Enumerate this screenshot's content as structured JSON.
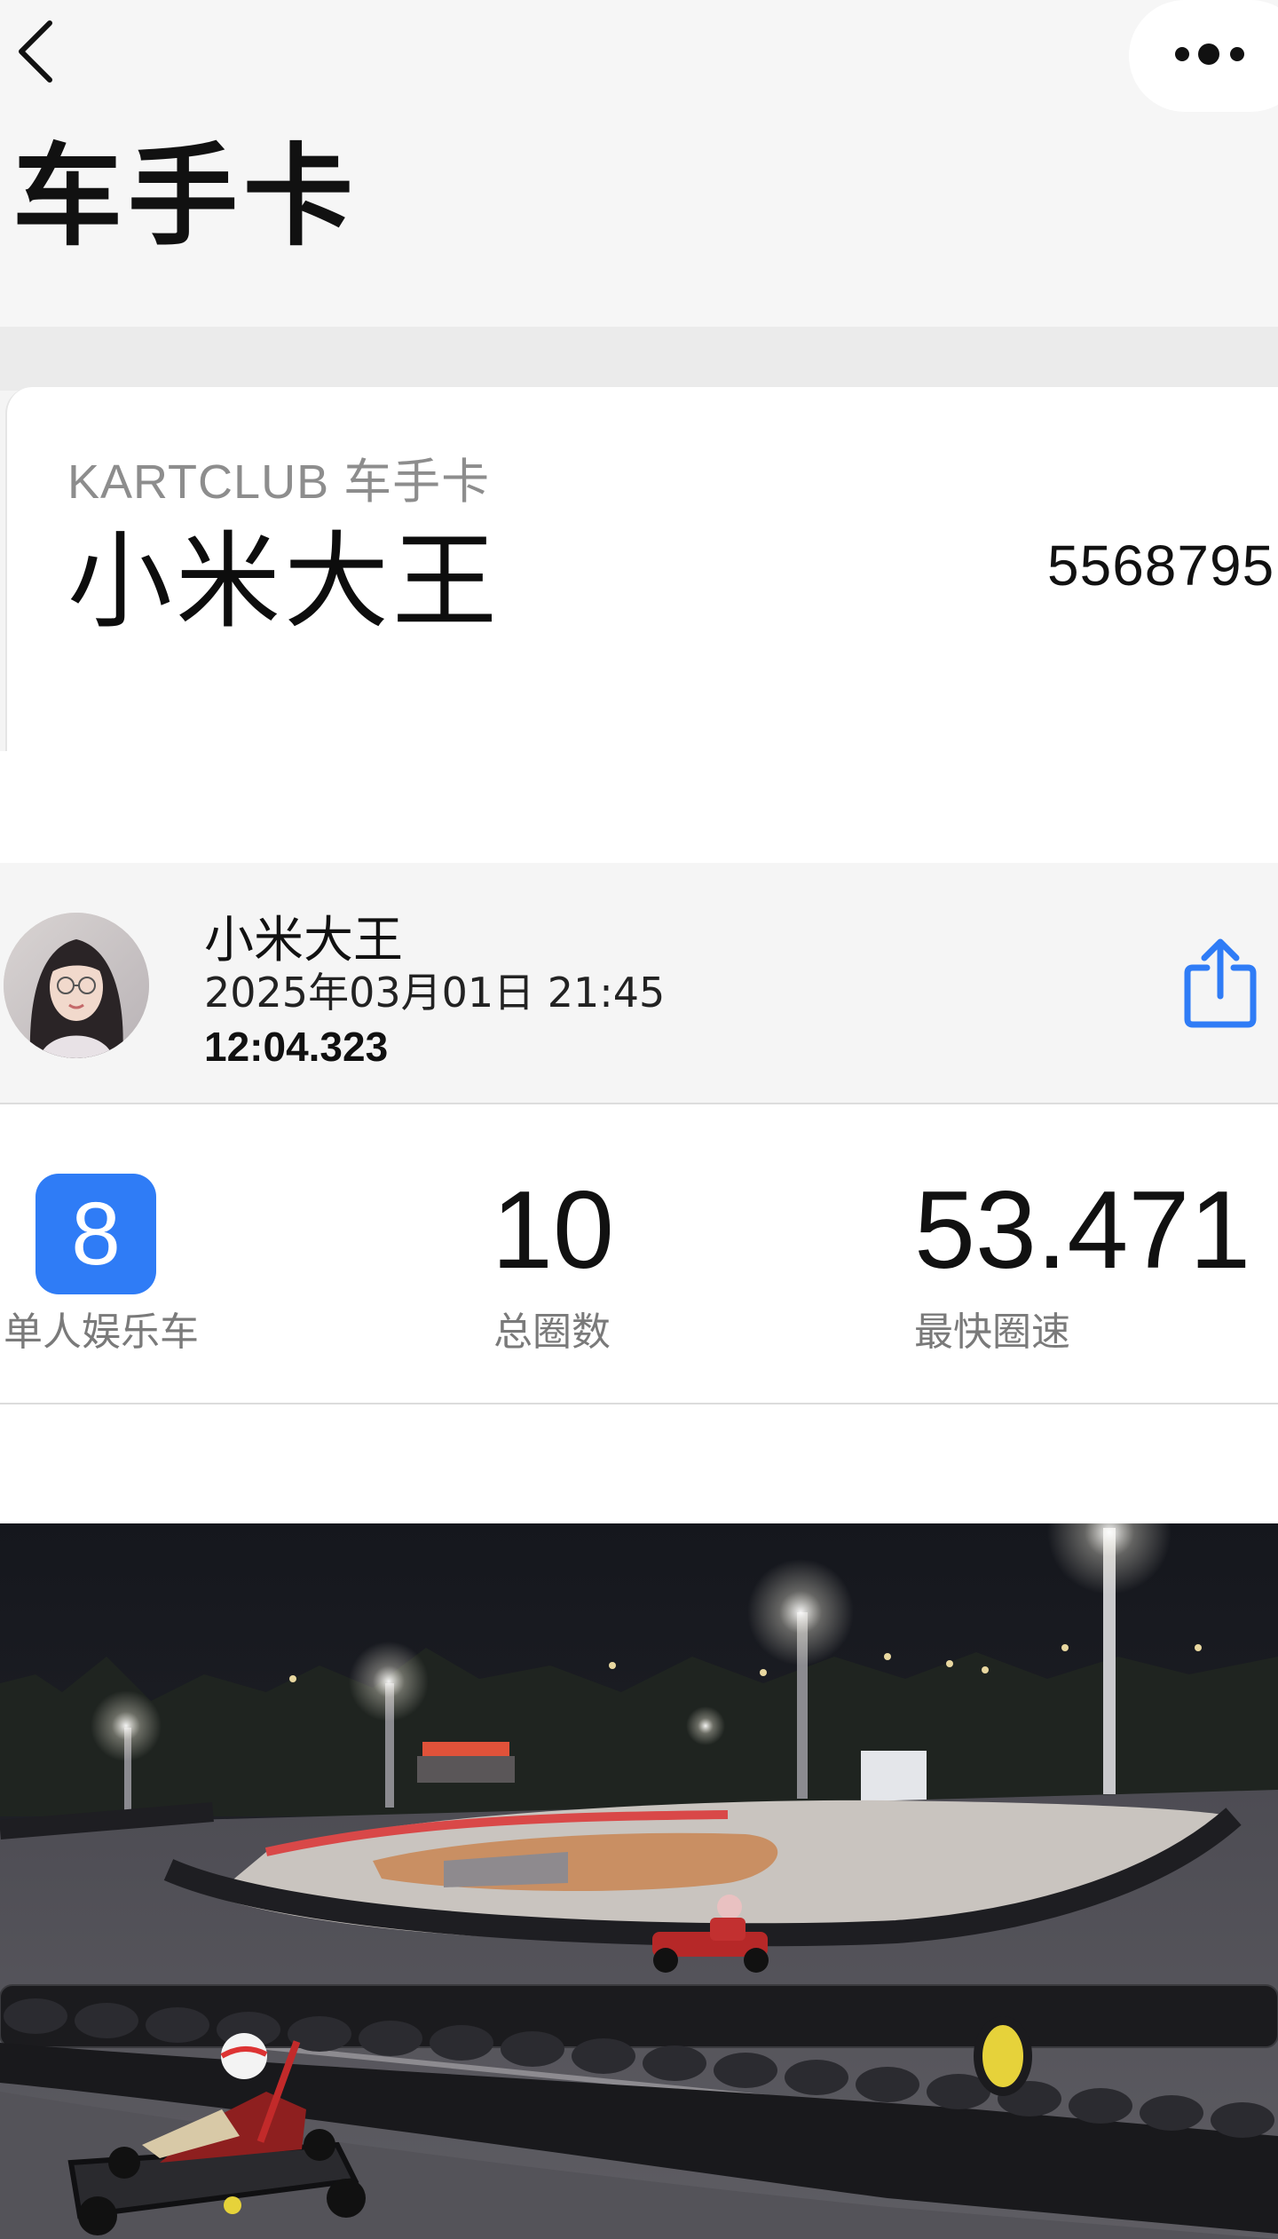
{
  "header": {
    "title": "车手卡",
    "back_icon": "chevron-left-icon",
    "more_icon": "more-dots-icon"
  },
  "card": {
    "kicker": "KARTCLUB 车手卡",
    "name": "小米大王",
    "member_id": "5568795"
  },
  "session": {
    "name": "小米大王",
    "datetime": "2025年03月01日 21:45",
    "duration": "12:04.323",
    "share_icon": "share-icon",
    "share_color": "#2f7cf6"
  },
  "stats": {
    "kart_number": "8",
    "kart_type": "单人娱乐车",
    "total_laps": "10",
    "total_laps_label": "总圈数",
    "best_lap": "53.471",
    "best_lap_label": "最快圈速",
    "accent": "#2f7cf6"
  }
}
